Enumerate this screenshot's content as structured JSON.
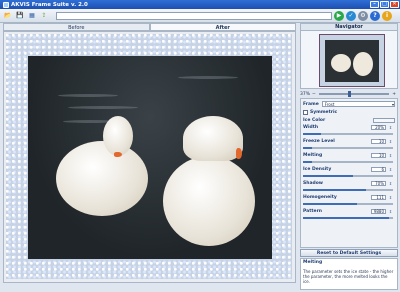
{
  "app": {
    "title": "AKVIS Frame Suite v. 2.0"
  },
  "toolbar": {
    "path_value": ""
  },
  "tabs": [
    {
      "label": "Before"
    },
    {
      "label": "After"
    }
  ],
  "navigator": {
    "title": "Navigator",
    "zoom": "37%"
  },
  "settings": {
    "frame_label": "Frame",
    "frame_value": "Frost",
    "symmetric_label": "Symmetric",
    "ice_color_label": "Ice Color",
    "params": [
      {
        "label": "Width",
        "value": "20%",
        "fraction": 0.2
      },
      {
        "label": "Freeze Level",
        "value": "10",
        "fraction": 0.1
      },
      {
        "label": "Melting",
        "value": "10",
        "fraction": 0.1
      },
      {
        "label": "Ice Density",
        "value": "6",
        "fraction": 0.55
      },
      {
        "label": "Shadow",
        "value": "70%",
        "fraction": 0.7
      },
      {
        "label": "Homogeneity",
        "value": "111",
        "fraction": 0.6
      },
      {
        "label": "Pattern",
        "value": "9880",
        "fraction": 0.95
      }
    ]
  },
  "reset_label": "Reset to Default Settings",
  "help": {
    "title": "Melting",
    "text": "The parameter sets the ice state - the higher the parameter, the more melted looks the ice."
  },
  "colors": {
    "titlebar": "#2f6fd6",
    "accent": "#3e6db5",
    "go": "#27a84a"
  }
}
